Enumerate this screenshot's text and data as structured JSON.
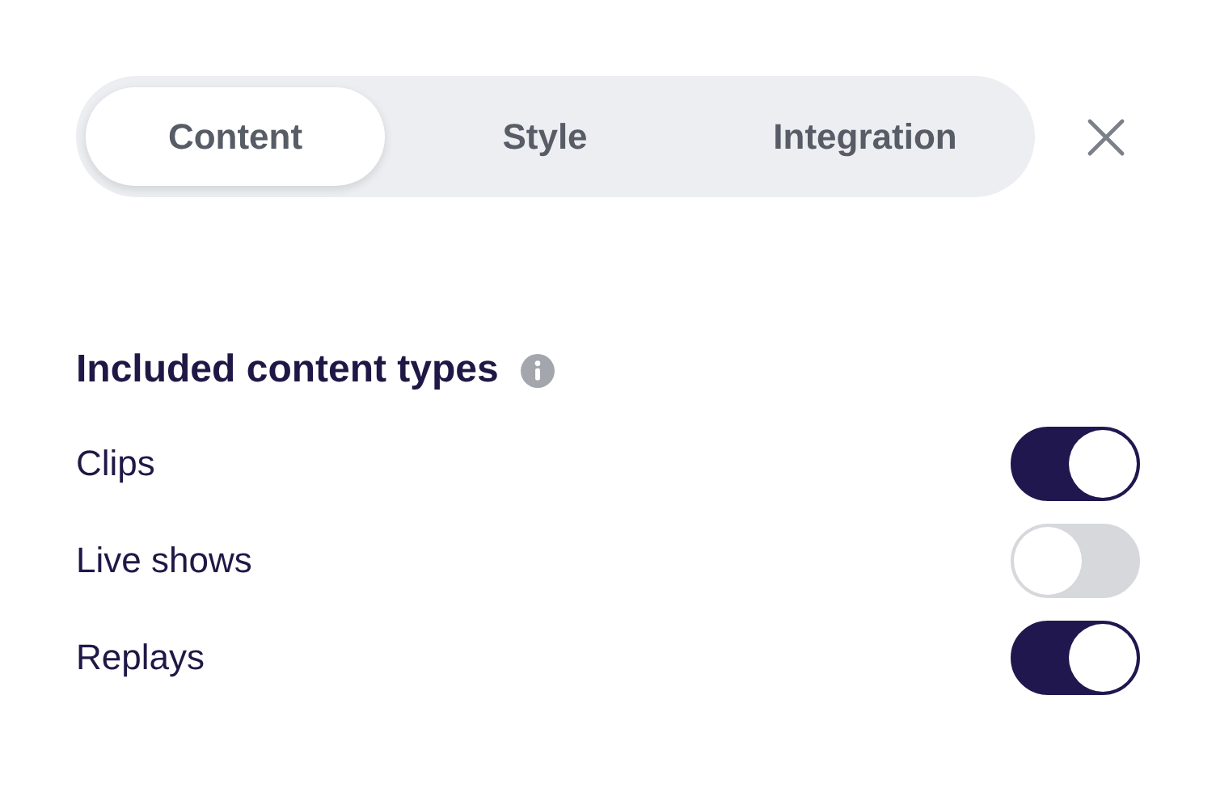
{
  "tabs": [
    {
      "label": "Content",
      "selected": true
    },
    {
      "label": "Style",
      "selected": false
    },
    {
      "label": "Integration",
      "selected": false
    }
  ],
  "section": {
    "title": "Included content types"
  },
  "toggles": [
    {
      "label": "Clips",
      "on": true
    },
    {
      "label": "Live shows",
      "on": false
    },
    {
      "label": "Replays",
      "on": true
    }
  ]
}
